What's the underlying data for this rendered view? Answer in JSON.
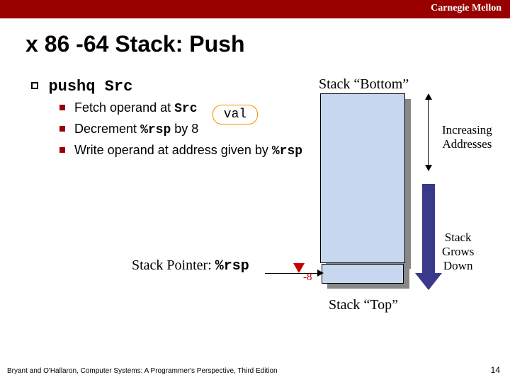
{
  "header": {
    "org": "Carnegie Mellon"
  },
  "title": "x 86 -64 Stack: Push",
  "bullet": {
    "label_a": "pushq ",
    "label_b": "Src"
  },
  "sub": {
    "l1a": "Fetch operand at ",
    "l1b": "Src",
    "l2a": "Decrement ",
    "l2b": "%rsp",
    "l2c": " by 8",
    "l3a": "Write operand at address given by ",
    "l3b": "%rsp"
  },
  "val": "val",
  "diagram": {
    "bottom": "Stack “Bottom”",
    "top": "Stack “Top”",
    "inc1": "Increasing",
    "inc2": "Addresses",
    "grows1": "Stack",
    "grows2": "Grows",
    "grows3": "Down",
    "sp_a": "Stack Pointer: ",
    "sp_b": "%rsp",
    "delta": "-8"
  },
  "footer": "Bryant and O'Hallaron, Computer Systems: A Programmer's Perspective, Third Edition",
  "page": "14"
}
